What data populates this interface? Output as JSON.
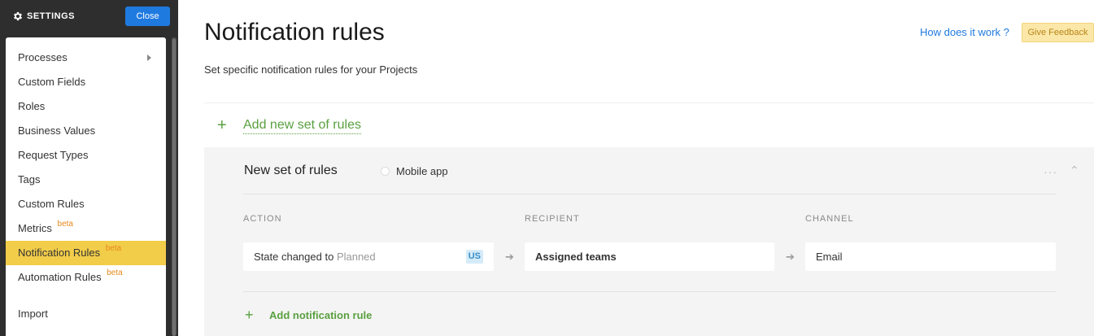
{
  "sidebar": {
    "title": "SETTINGS",
    "close_label": "Close",
    "items": [
      {
        "label": "Processes",
        "beta": ""
      },
      {
        "label": "Custom Fields",
        "beta": ""
      },
      {
        "label": "Roles",
        "beta": ""
      },
      {
        "label": "Business Values",
        "beta": ""
      },
      {
        "label": "Request Types",
        "beta": ""
      },
      {
        "label": "Tags",
        "beta": ""
      },
      {
        "label": "Custom Rules",
        "beta": ""
      },
      {
        "label": "Metrics",
        "beta": "beta"
      },
      {
        "label": "Notification Rules",
        "beta": "beta"
      },
      {
        "label": "Automation Rules",
        "beta": "beta"
      },
      {
        "label": "Import",
        "beta": ""
      }
    ],
    "active_item": "Notification Rules"
  },
  "header": {
    "title": "Notification rules",
    "subtitle": "Set specific notification rules for your Projects",
    "how_link": "How does it work ?",
    "feedback_label": "Give Feedback"
  },
  "main": {
    "add_set_label": "Add new set of rules",
    "rule_set": {
      "name": "New set of rules",
      "mobile_label": "Mobile app",
      "columns": [
        "ACTION",
        "RECIPIENT",
        "CHANNEL"
      ],
      "rule": {
        "action_prefix": "State changed to",
        "action_value": "Planned",
        "action_badge": "US",
        "recipient": "Assigned teams",
        "channel": "Email"
      },
      "add_rule_label": "Add notification rule"
    }
  },
  "colors": {
    "accent_blue": "#1f7ae0",
    "active_yellow": "#f2cd4a",
    "green": "#5aa040",
    "beta_orange": "#e8891c"
  }
}
